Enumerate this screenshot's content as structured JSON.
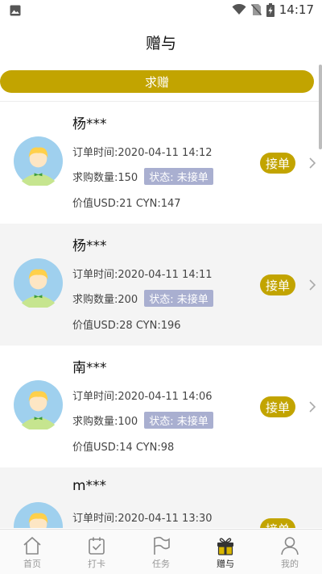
{
  "status_bar": {
    "time": "14:17",
    "icons": [
      "image-icon",
      "wifi-icon",
      "no-sim-icon",
      "battery-charging-icon"
    ]
  },
  "header": {
    "title": "赠与"
  },
  "request_button": {
    "label": "求赠"
  },
  "orders": [
    {
      "name": "杨***",
      "order_time": "订单时间:2020-04-11 14:12",
      "quantity": "求购数量:150",
      "status": "状态: 未接单",
      "value": "价值USD:21 CYN:147",
      "action": "接单"
    },
    {
      "name": "杨***",
      "order_time": "订单时间:2020-04-11 14:11",
      "quantity": "求购数量:200",
      "status": "状态: 未接单",
      "value": "价值USD:28 CYN:196",
      "action": "接单"
    },
    {
      "name": "南***",
      "order_time": "订单时间:2020-04-11 14:06",
      "quantity": "求购数量:100",
      "status": "状态: 未接单",
      "value": "价值USD:14 CYN:98",
      "action": "接单"
    },
    {
      "name": "m***",
      "order_time": "订单时间:2020-04-11 13:30",
      "quantity": "",
      "status": "",
      "value": "",
      "action": "接单"
    }
  ],
  "bottom_nav": [
    {
      "label": "首页",
      "icon": "home-icon"
    },
    {
      "label": "打卡",
      "icon": "checkin-icon"
    },
    {
      "label": "任务",
      "icon": "flag-icon"
    },
    {
      "label": "赠与",
      "icon": "gift-icon",
      "active": true
    },
    {
      "label": "我的",
      "icon": "user-icon"
    }
  ],
  "colors": {
    "accent": "#c2a400",
    "status_badge": "#a9afd0",
    "avatar_bg": "#9fd0ee"
  }
}
